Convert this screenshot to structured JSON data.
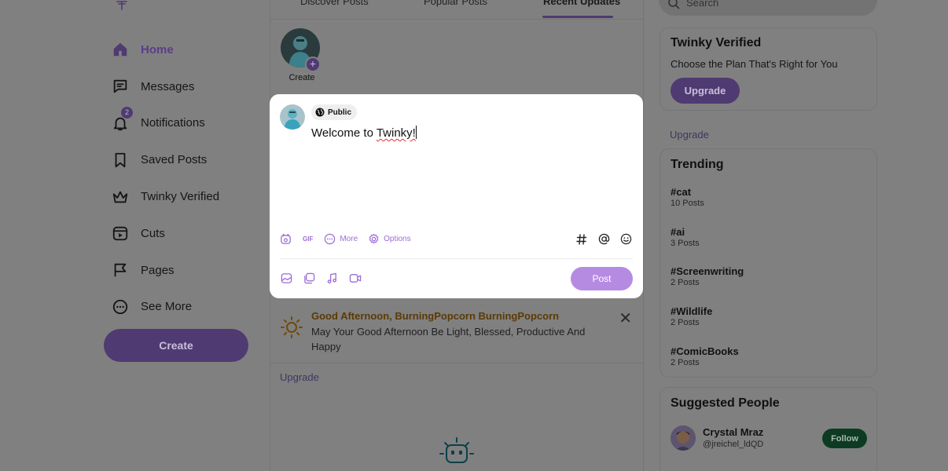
{
  "nav": {
    "items": [
      {
        "label": "Home",
        "icon": "home-icon",
        "active": true
      },
      {
        "label": "Messages",
        "icon": "message-icon"
      },
      {
        "label": "Notifications",
        "icon": "bell-icon",
        "badge": "2"
      },
      {
        "label": "Saved Posts",
        "icon": "bookmark-icon"
      },
      {
        "label": "Twinky Verified",
        "icon": "crown-icon"
      },
      {
        "label": "Cuts",
        "icon": "cuts-icon"
      },
      {
        "label": "Pages",
        "icon": "flag-icon"
      },
      {
        "label": "See More",
        "icon": "more-icon"
      }
    ],
    "create_label": "Create"
  },
  "tabs": {
    "discover": "Discover Posts",
    "popular": "Popular Posts",
    "recent": "Recent Updates"
  },
  "story": {
    "label": "Create"
  },
  "greeting": {
    "title": "Good Afternoon, BurningPopcorn BurningPopcorn",
    "body": "May Your Good Afternoon Be Light, Blessed, Productive And Happy"
  },
  "feed": {
    "upgrade_link": "Upgrade"
  },
  "search": {
    "placeholder": "Search"
  },
  "verified": {
    "title": "Twinky Verified",
    "subtitle": "Choose the Plan That's Right for You",
    "button": "Upgrade",
    "link": "Upgrade"
  },
  "trending": {
    "title": "Trending",
    "items": [
      {
        "tag": "#cat",
        "count": "10 Posts"
      },
      {
        "tag": "#ai",
        "count": "3 Posts"
      },
      {
        "tag": "#Screenwriting",
        "count": "2 Posts"
      },
      {
        "tag": "#Wildlife",
        "count": "2 Posts"
      },
      {
        "tag": "#ComicBooks",
        "count": "2 Posts"
      }
    ]
  },
  "suggested": {
    "title": "Suggested People",
    "people": [
      {
        "name": "Crystal Mraz",
        "handle": "@jreichel_ldQD",
        "button": "Follow"
      }
    ]
  },
  "composer": {
    "audience": "Public",
    "text_before": "Welcome to ",
    "text_misspelled": "Twinky!",
    "toolbar": {
      "gif": "GIF",
      "more": "More",
      "options": "Options"
    },
    "post_label": "Post"
  },
  "colors": {
    "accent": "#9b6cd6",
    "post_button": "#b58be2",
    "greeting_title": "#e08a12",
    "follow_button": "#1a7a45"
  }
}
